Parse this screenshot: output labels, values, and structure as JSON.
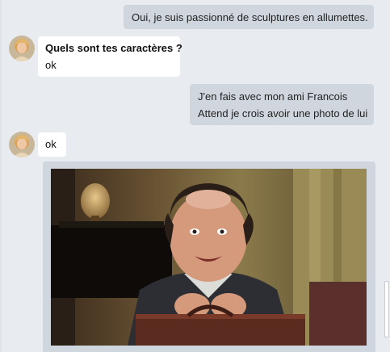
{
  "messages": [
    {
      "direction": "out",
      "lines": [
        "Oui, je suis passionné de sculptures en allumettes."
      ]
    },
    {
      "direction": "in",
      "sender": "Quels sont tes caractères ?",
      "lines": [
        "ok"
      ]
    },
    {
      "direction": "out",
      "lines": [
        "J'en fais avec mon ami Francois",
        "Attend je crois avoir une photo de lui"
      ]
    },
    {
      "direction": "in",
      "lines": [
        "ok"
      ]
    },
    {
      "direction": "out",
      "attachment": "photo"
    }
  ],
  "icons": {
    "avatar": "user-avatar-icon"
  },
  "colors": {
    "background": "#e8ebf0",
    "outgoing_bubble": "#cfd6de",
    "incoming_bubble": "#ffffff"
  }
}
